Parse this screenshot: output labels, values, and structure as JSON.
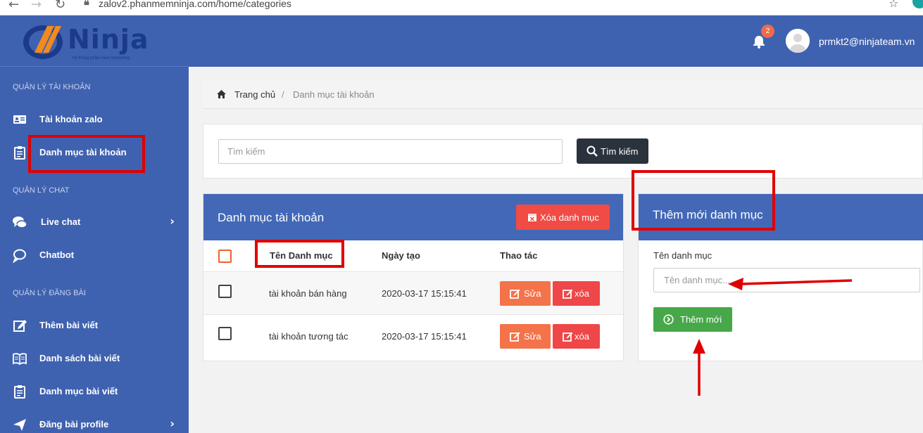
{
  "browser": {
    "url": "zalov2.phanmemninja.com/home/categories"
  },
  "brand": {
    "logo_text": "Ninja",
    "logo_tagline": "Hệ thống phần mềm Marketing"
  },
  "sidebar": {
    "sections": [
      {
        "title": "QUẢN LÝ TÀI KHOẢN"
      },
      {
        "title": "QUẢN LÝ CHAT"
      },
      {
        "title": "QUẢN LÝ ĐĂNG BÀI"
      }
    ],
    "items": [
      {
        "label": "Tài khoản zalo",
        "icon": "id-card-icon"
      },
      {
        "label": "Danh mục tài khoản",
        "icon": "clipboard-icon"
      },
      {
        "label": "Live chat",
        "icon": "chat-bubbles-icon"
      },
      {
        "label": "Chatbot",
        "icon": "chat-bubble-icon"
      },
      {
        "label": "Thêm bài viết",
        "icon": "edit-icon"
      },
      {
        "label": "Danh sách bài viết",
        "icon": "book-icon"
      },
      {
        "label": "Danh mục bài viết",
        "icon": "clipboard-icon"
      },
      {
        "label": "Đăng bài profile",
        "icon": "send-icon"
      }
    ]
  },
  "header": {
    "notification_count": "2",
    "user_email": "prmkt2@ninjateam.vn"
  },
  "breadcrumb": {
    "home": "Trang chủ",
    "separator": "/",
    "current": "Danh mục tài khoản"
  },
  "search": {
    "placeholder": "Tìm kiếm",
    "button_label": "Tìm kiếm"
  },
  "categories": {
    "title": "Danh mục tài khoản",
    "delete_button": "Xóa danh mục",
    "columns": [
      "Tên Danh mục",
      "Ngày tạo",
      "Thao tác"
    ],
    "rows": [
      {
        "name": "tài khoản bán hàng",
        "created": "2020-03-17 15:15:41",
        "edit": "Sửa",
        "delete": "xóa"
      },
      {
        "name": "tài khoản tương tác",
        "created": "2020-03-17 15:15:41",
        "edit": "Sửa",
        "delete": "xóa"
      }
    ]
  },
  "add_category": {
    "title": "Thêm mới danh mục",
    "field_label": "Tên danh mục",
    "placeholder": "Tên danh mục...",
    "button_label": "Thêm mới"
  },
  "colors": {
    "sidebar": "#3f62b0",
    "card_header": "#4368b7",
    "edit": "#f4734a",
    "delete": "#ef4747",
    "add": "#47a84a",
    "annotation": "#e00000"
  }
}
